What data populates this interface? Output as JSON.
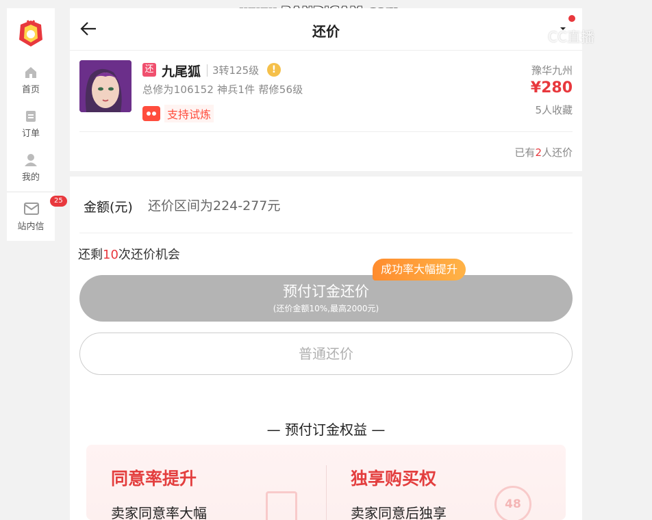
{
  "watermark": "www.BANDICAM.com",
  "cc_watermark": "CC直播",
  "sidebar": {
    "items": [
      {
        "label": "首页",
        "icon": "home-icon"
      },
      {
        "label": "订单",
        "icon": "order-icon"
      },
      {
        "label": "我的",
        "icon": "user-icon"
      },
      {
        "label": "站内信",
        "icon": "mail-icon",
        "badge": "25"
      }
    ]
  },
  "header": {
    "title": "还价"
  },
  "product": {
    "tag": "还",
    "name": "九尾狐",
    "level": "3转125级",
    "stats": "总修为106152  神兵1件  帮修56级",
    "trial": "支持试炼",
    "server": "豫华九州",
    "price": "¥280",
    "favorites": "5人收藏",
    "haggled_prefix": "已有",
    "haggled_count": "2",
    "haggled_suffix": "人还价"
  },
  "haggle": {
    "amount_label": "金额(元)",
    "amount_range": "还价区间为224-277元",
    "remain_prefix": "还剩",
    "remain_count": "10",
    "remain_suffix": "次还价机会",
    "promo": "成功率大幅提升",
    "prepay_label": "预付订金还价",
    "prepay_sub": "(还价金额10%,最高2000元)",
    "normal_label": "普通还价"
  },
  "benefits": {
    "title": "—  预付订金权益  —",
    "items": [
      {
        "head": "同意率提升",
        "desc": "卖家同意率大幅"
      },
      {
        "head": "独享购买权",
        "desc": "卖家同意后独享",
        "deco": "48"
      }
    ]
  },
  "colors": {
    "accent": "#e8383d",
    "promo": "#ff9a3c",
    "disabled": "#b4b4b4"
  }
}
